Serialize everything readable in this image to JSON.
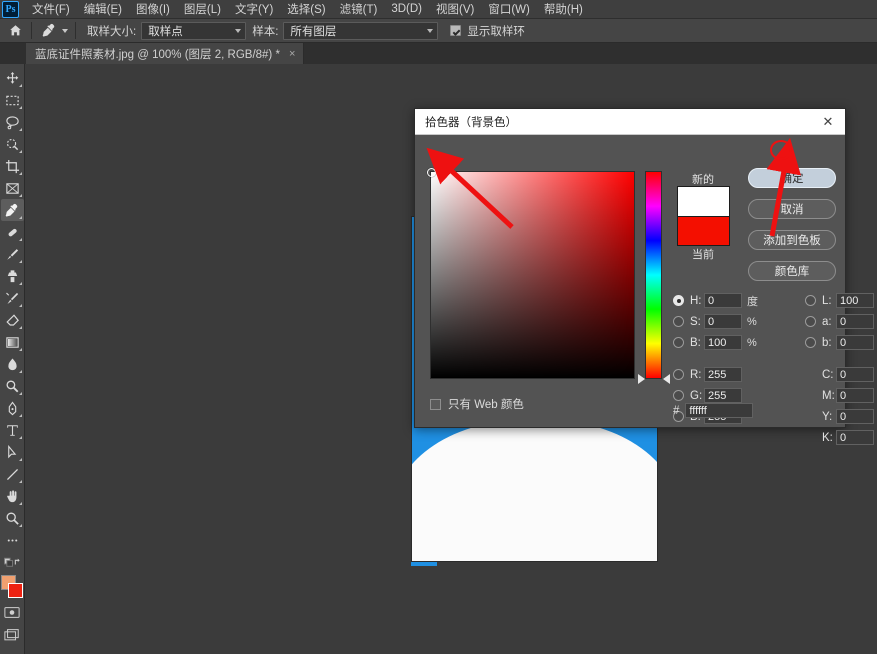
{
  "app": {
    "logo": "Ps"
  },
  "menubar": {
    "items": [
      {
        "label": "文件(F)",
        "name": "menu-file"
      },
      {
        "label": "编辑(E)",
        "name": "menu-edit"
      },
      {
        "label": "图像(I)",
        "name": "menu-image"
      },
      {
        "label": "图层(L)",
        "name": "menu-layer"
      },
      {
        "label": "文字(Y)",
        "name": "menu-type"
      },
      {
        "label": "选择(S)",
        "name": "menu-select"
      },
      {
        "label": "滤镜(T)",
        "name": "menu-filter"
      },
      {
        "label": "3D(D)",
        "name": "menu-3d"
      },
      {
        "label": "视图(V)",
        "name": "menu-view"
      },
      {
        "label": "窗口(W)",
        "name": "menu-window"
      },
      {
        "label": "帮助(H)",
        "name": "menu-help"
      }
    ]
  },
  "options_bar": {
    "tool_icon": "eyedropper-icon",
    "sample_size_label": "取样大小:",
    "sample_size_value": "取样点",
    "sample_label": "样本:",
    "sample_value": "所有图层",
    "show_ring_label": "显示取样环",
    "show_ring_checked": true
  },
  "document_tab": {
    "title": "蓝底证件照素材.jpg @ 100% (图层 2, RGB/8#) *",
    "close": "×"
  },
  "toolbar": {
    "tools": [
      {
        "name": "move-tool",
        "icon": "move-icon"
      },
      {
        "name": "marquee-tool",
        "icon": "rectangular-marquee-icon"
      },
      {
        "name": "lasso-tool",
        "icon": "lasso-icon"
      },
      {
        "name": "quick-selection-tool",
        "icon": "quick-selection-icon"
      },
      {
        "name": "crop-tool",
        "icon": "crop-icon"
      },
      {
        "name": "frame-tool",
        "icon": "frame-icon"
      },
      {
        "name": "eyedropper-tool",
        "icon": "eyedropper-icon",
        "active": true
      },
      {
        "name": "healing-brush-tool",
        "icon": "healing-brush-icon"
      },
      {
        "name": "brush-tool",
        "icon": "brush-icon"
      },
      {
        "name": "clone-stamp-tool",
        "icon": "clone-stamp-icon"
      },
      {
        "name": "history-brush-tool",
        "icon": "history-brush-icon"
      },
      {
        "name": "eraser-tool",
        "icon": "eraser-icon"
      },
      {
        "name": "gradient-tool",
        "icon": "gradient-icon"
      },
      {
        "name": "blur-tool",
        "icon": "blur-drop-icon"
      },
      {
        "name": "dodge-tool",
        "icon": "dodge-icon"
      },
      {
        "name": "pen-tool",
        "icon": "pen-icon"
      },
      {
        "name": "type-tool",
        "icon": "type-t-icon"
      },
      {
        "name": "path-selection-tool",
        "icon": "path-arrow-icon"
      },
      {
        "name": "line-tool",
        "icon": "line-icon"
      },
      {
        "name": "hand-tool",
        "icon": "hand-icon"
      },
      {
        "name": "zoom-tool",
        "icon": "magnifier-icon"
      },
      {
        "name": "edit-toolbar",
        "icon": "ellipsis-icon"
      },
      {
        "name": "default-colors",
        "icon": "default-colors-icon"
      },
      {
        "name": "swap-colors",
        "icon": "swap-colors-icon"
      }
    ],
    "foreground_color": "#f0a070",
    "background_color": "#ee2211",
    "quick_mask": "quick-mask-icon",
    "screen_mode": "screen-mode-icon"
  },
  "dialog": {
    "title": "拾色器（背景色）",
    "close": "✕",
    "preview": {
      "new_label": "新的",
      "current_label": "当前",
      "new_color": "#ffffff",
      "current_color": "#f40f00"
    },
    "buttons": [
      {
        "label": "确定",
        "name": "ok-button",
        "primary": true
      },
      {
        "label": "取消",
        "name": "cancel-button",
        "primary": false
      },
      {
        "label": "添加到色板",
        "name": "add-to-swatches-button",
        "primary": false
      },
      {
        "label": "颜色库",
        "name": "color-libraries-button",
        "primary": false
      }
    ],
    "web_only_label": "只有 Web 颜色",
    "web_only_checked": false,
    "hsb": [
      {
        "label": "H:",
        "value": "0",
        "unit": "度",
        "selected": true,
        "name": "hue-field"
      },
      {
        "label": "S:",
        "value": "0",
        "unit": "%",
        "selected": false,
        "name": "saturation-field"
      },
      {
        "label": "B:",
        "value": "100",
        "unit": "%",
        "selected": false,
        "name": "brightness-field"
      }
    ],
    "rgb": [
      {
        "label": "R:",
        "value": "255",
        "unit": "",
        "selected": false,
        "name": "red-field"
      },
      {
        "label": "G:",
        "value": "255",
        "unit": "",
        "selected": false,
        "name": "green-field"
      },
      {
        "label": "B:",
        "value": "255",
        "unit": "",
        "selected": false,
        "name": "blue-field"
      }
    ],
    "lab": [
      {
        "label": "L:",
        "value": "100",
        "unit": "",
        "selected": false,
        "name": "lab-l-field"
      },
      {
        "label": "a:",
        "value": "0",
        "unit": "",
        "selected": false,
        "name": "lab-a-field"
      },
      {
        "label": "b:",
        "value": "0",
        "unit": "",
        "selected": false,
        "name": "lab-b-field"
      }
    ],
    "cmyk": [
      {
        "label": "C:",
        "value": "0",
        "unit": "%",
        "name": "cyan-field"
      },
      {
        "label": "M:",
        "value": "0",
        "unit": "%",
        "name": "magenta-field"
      },
      {
        "label": "Y:",
        "value": "0",
        "unit": "%",
        "name": "yellow-field"
      },
      {
        "label": "K:",
        "value": "0",
        "unit": "%",
        "name": "black-field"
      }
    ],
    "hex_symbol": "#",
    "hex_value": "ffffff"
  },
  "annotations": {
    "accent_color": "#ee1111",
    "arrow_to_field": "arrow pointing to color field top-left",
    "arrow_to_ok": "arrow pointing to 确定 button"
  }
}
